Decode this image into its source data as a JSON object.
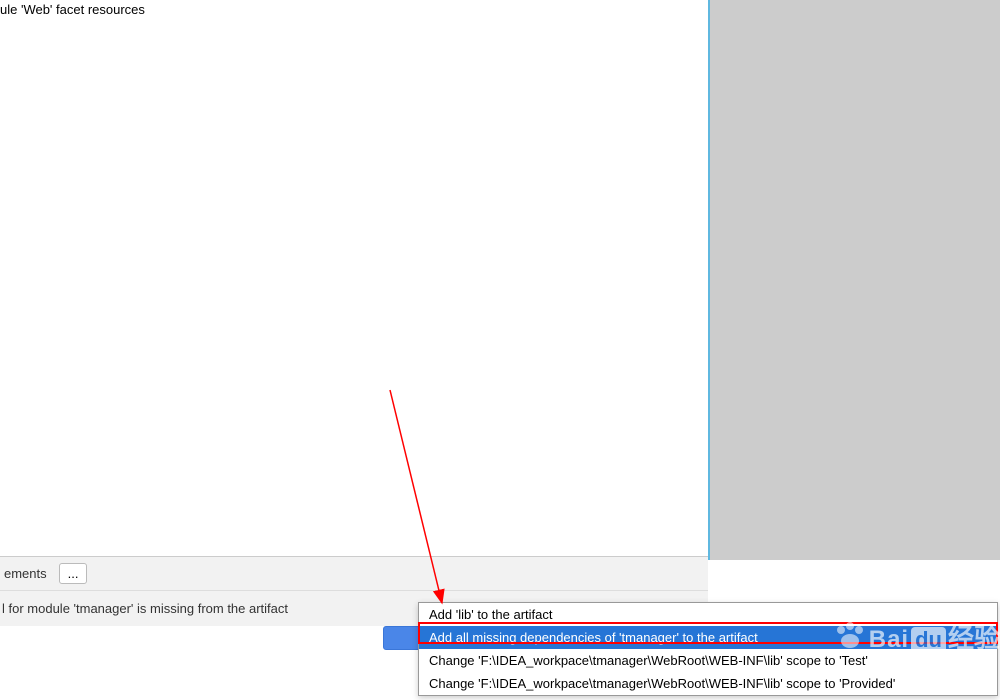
{
  "top": {
    "partial_text": "ule 'Web' facet resources"
  },
  "bottom": {
    "elements_label": "ements",
    "dots_button": "...",
    "warning_text": "l for module 'tmanager' is missing from the artifact"
  },
  "menu": {
    "items": [
      "Add 'lib' to the artifact",
      "Add all missing dependencies of 'tmanager' to the artifact",
      "Change 'F:\\IDEA_workpace\\tmanager\\WebRoot\\WEB-INF\\lib' scope to 'Test'",
      "Change 'F:\\IDEA_workpace\\tmanager\\WebRoot\\WEB-INF\\lib' scope to 'Provided'"
    ],
    "highlighted_index": 1
  },
  "watermark": {
    "bai": "Bai",
    "du": "du",
    "jingyan": "经验"
  }
}
